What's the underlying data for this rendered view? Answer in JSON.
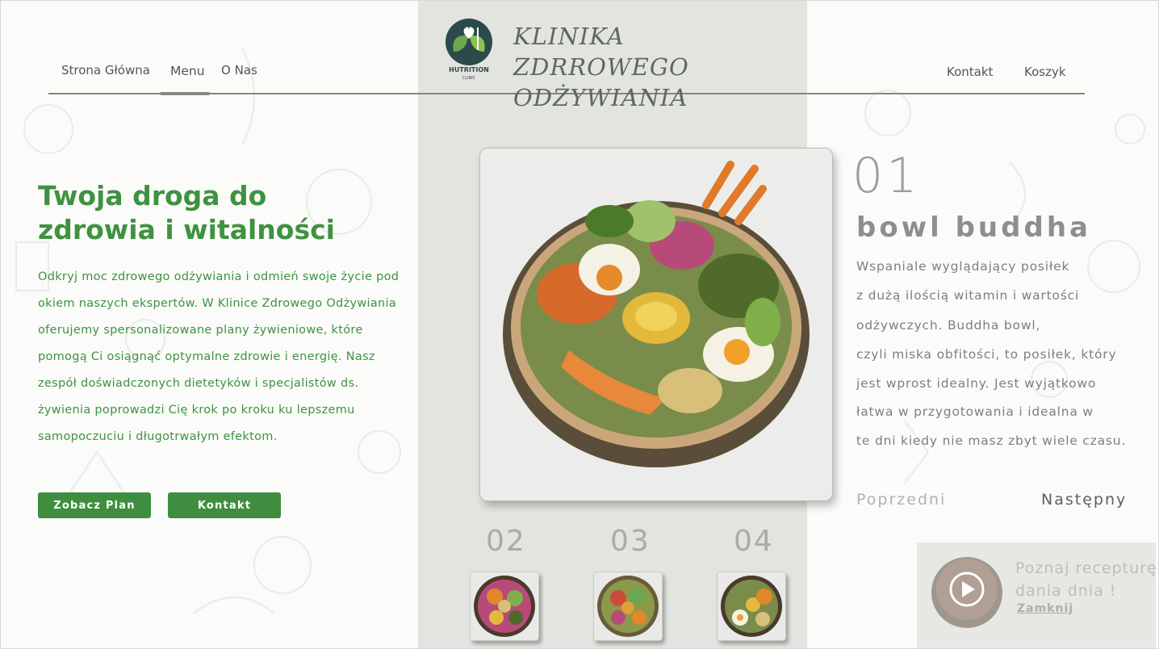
{
  "nav": {
    "left_items": [
      "Strona Główna",
      "Menu",
      "O Nas"
    ],
    "right_items": [
      "Kontakt",
      "Koszyk"
    ],
    "active": "Menu"
  },
  "brand": {
    "logo_text_1": "HUTRITION",
    "logo_text_2": "CLINIC",
    "name_line1": "KLINIKA ZDRROWEGO",
    "name_line2": "ODŻYWIANIA"
  },
  "hero": {
    "title": "Twoja droga do\n zdrowia i witalności",
    "text": "Odkryj moc zdrowego odżywiania i odmień swoje życie pod okiem naszych ekspertów. W Klinice  Zdrowego Odżywiania oferujemy spersonalizowane plany żywieniowe, które pomogą Ci osiągnąć optymalne zdrowie i energię. Nasz zespół doświadczonych dietetyków i specjalistów ds. żywienia poprowadzi Cię krok po kroku ku lepszemu samopoczuciu i długotrwałym efektom.",
    "btn_plan": "Zobacz Plan",
    "btn_contact": "Kontakt"
  },
  "dish": {
    "number": "01",
    "title": "bowl buddha",
    "lines": [
      "Wspaniale wyglądający posiłek",
      "z dużą ilością witamin i wartości",
      "odżywczych. Buddha bowl,",
      "czyli miska obfitości, to posiłek, który",
      "jest wprost idealny. Jest wyjątkowo",
      "łatwa w przygotowania i idealna w",
      "te dni kiedy nie masz zbyt wiele czasu."
    ],
    "prev": "Poprzedni",
    "next": "Następny"
  },
  "thumbs": [
    {
      "number": "02"
    },
    {
      "number": "03"
    },
    {
      "number": "04"
    }
  ],
  "popup": {
    "text": "Poznaj recepturę dania dnia !",
    "close": "Zamknij"
  },
  "colors": {
    "accent_green": "#3f8e3f",
    "center_panel": "#e3e4df",
    "brand_text": "#5b6b57"
  }
}
